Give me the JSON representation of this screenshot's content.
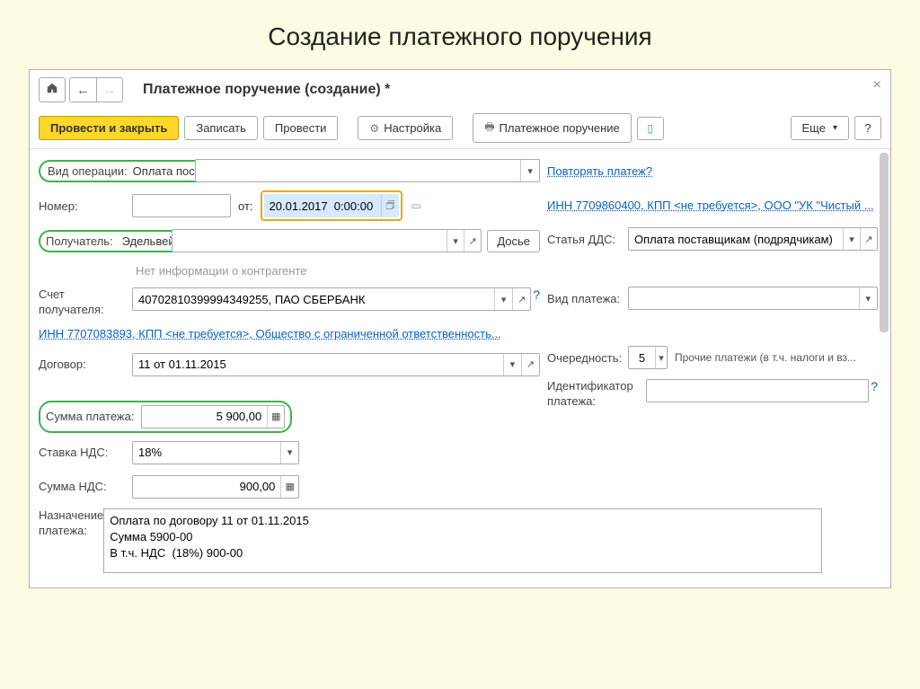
{
  "slide_title": "Создание платежного поручения",
  "window": {
    "title": "Платежное поручение (создание) *"
  },
  "toolbar": {
    "post_close": "Провести и закрыть",
    "save": "Записать",
    "post": "Провести",
    "settings": "Настройка",
    "paydoc": "Платежное поручение",
    "more": "Еще",
    "help": "?"
  },
  "left": {
    "op_type_label": "Вид операции:",
    "op_type_value": "Оплата поставщику",
    "number_label": "Номер:",
    "number_value": "",
    "from_label": "от:",
    "date_value": "20.01.2017  0:00:00",
    "recipient_label": "Получатель:",
    "recipient_value": "Эдельвейс ООО",
    "dossier": "Досье",
    "counterparty_info": "Нет информации о контрагенте",
    "account_label": "Счет получателя:",
    "account_value": "40702810399994349255, ПАО СБЕРБАНК",
    "org_link": "ИНН 7707083893, КПП <не требуется>, Общество с ограниченной ответственность...",
    "contract_label": "Договор:",
    "contract_value": "11 от 01.11.2015",
    "amount_label": "Сумма платежа:",
    "amount_value": "5 900,00",
    "vat_rate_label": "Ставка НДС:",
    "vat_rate_value": "18%",
    "vat_sum_label": "Сумма НДС:",
    "vat_sum_value": "900,00",
    "purpose_label": "Назначение платежа:",
    "purpose_value": "Оплата по договору 11 от 01.11.2015\nСумма 5900-00\nВ т.ч. НДС  (18%) 900-00"
  },
  "right": {
    "repeat_link": "Повторять платеж?",
    "org_link": "ИНН 7709860400, КПП <не требуется>, ООО \"УК \"Чистый ...",
    "dds_label": "Статья ДДС:",
    "dds_value": "Оплата поставщикам (подрядчикам)",
    "paytype_label": "Вид платежа:",
    "paytype_value": "",
    "priority_label": "Очередность:",
    "priority_value": "5",
    "priority_desc": "Прочие платежи (в т.ч. налоги и вз...",
    "identifier_label": "Идентификатор платежа:",
    "identifier_value": ""
  }
}
